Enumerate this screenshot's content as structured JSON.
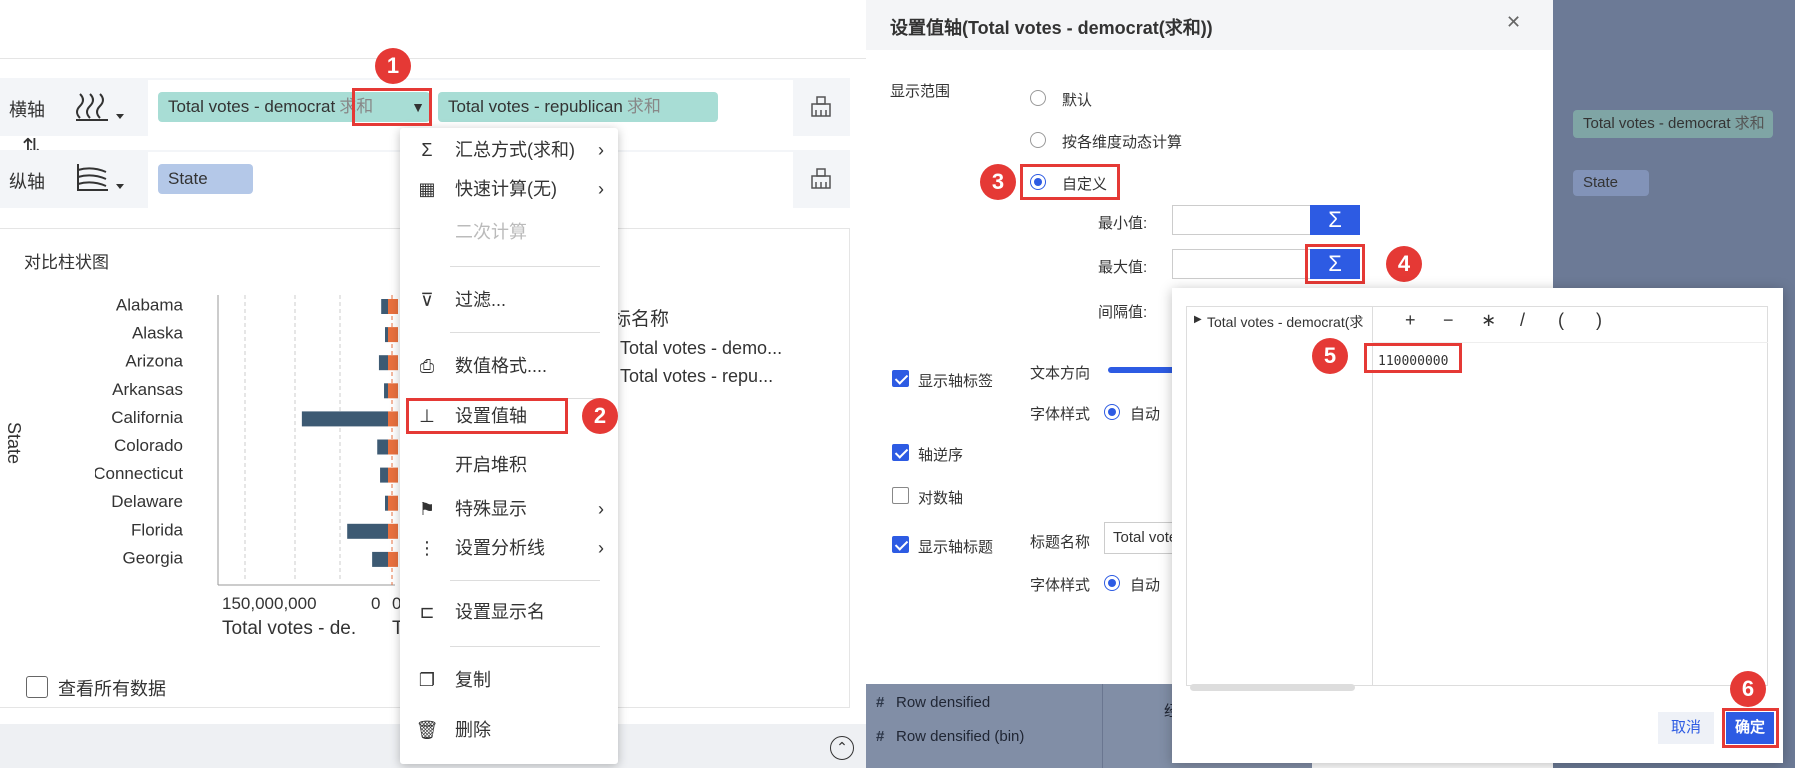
{
  "left": {
    "x_axis_label": "横轴",
    "y_axis_label": "纵轴",
    "swap_icon": "⇅",
    "x_pills": [
      {
        "name": "Total votes - democrat",
        "agg": "求和"
      },
      {
        "name": "Total votes - republican",
        "agg": "求和"
      }
    ],
    "y_pill": "State",
    "chart_title": "对比柱状图",
    "y_axis_title": "State",
    "legend_partial": "标名称",
    "legend_items": [
      "Total votes - demo...",
      "Total votes - repu..."
    ],
    "x_ticks": [
      "150,000,000",
      "0",
      "0"
    ],
    "x_title": "Total votes - de.",
    "x_title_2": "T",
    "view_all": "查看所有数据"
  },
  "chart_data": {
    "type": "bar",
    "categories": [
      "Alabama",
      "Alaska",
      "Arizona",
      "Arkansas",
      "California",
      "Colorado",
      "Connecticut",
      "Delaware",
      "Florida",
      "Georgia"
    ],
    "series": [
      {
        "name": "Total votes - democrat",
        "values": [
          6000000,
          1500000,
          8000000,
          3500000,
          76000000,
          9500000,
          7000000,
          2000000,
          36000000,
          14000000
        ]
      },
      {
        "name": "Total votes - republican",
        "values": [
          1,
          1,
          1,
          1,
          1,
          1,
          1,
          1,
          1,
          1
        ]
      }
    ],
    "colors": [
      "#3d5a73",
      "#e8703e"
    ]
  },
  "menu": {
    "items": [
      {
        "icon": "Σ",
        "label": "汇总方式(求和)",
        "arrow": "›"
      },
      {
        "icon": "▦",
        "label": "快速计算(无)",
        "arrow": "›"
      },
      {
        "icon": "",
        "label": "二次计算",
        "arrow": ""
      },
      {
        "icon": "⊽",
        "label": "过滤...",
        "arrow": ""
      },
      {
        "icon": "⎙",
        "label": "数值格式....",
        "arrow": ""
      },
      {
        "icon": "⊥",
        "label": "设置值轴",
        "arrow": ""
      },
      {
        "icon": "",
        "label": "开启堆积",
        "arrow": ""
      },
      {
        "icon": "⚑",
        "label": "特殊显示",
        "arrow": "›"
      },
      {
        "icon": "⋮",
        "label": "设置分析线",
        "arrow": "›"
      },
      {
        "icon": "⊏",
        "label": "设置显示名",
        "arrow": ""
      },
      {
        "icon": "❐",
        "label": "复制",
        "arrow": ""
      },
      {
        "icon": "🗑",
        "label": "删除",
        "arrow": ""
      }
    ]
  },
  "dialog": {
    "title": "设置值轴(Total votes - democrat(求和))",
    "close": "✕",
    "range_label": "显示范围",
    "opt_default": "默认",
    "opt_dynamic": "按各维度动态计算",
    "opt_custom": "自定义",
    "min_label": "最小值:",
    "max_label": "最大值:",
    "interval_label": "间隔值:",
    "sigma": "Σ",
    "show_axis_label": "显示轴标签",
    "text_direction": "文本方向",
    "font_style": "字体样式",
    "auto": "自动",
    "axis_reverse": "轴逆序",
    "log_axis": "对数轴",
    "show_axis_title": "显示轴标题",
    "title_name": "标题名称",
    "title_value": "Total vote",
    "field_rows": [
      "Row densified",
      "Row densified (bin)"
    ],
    "field_partial": "经"
  },
  "formula": {
    "tree_item": "Total votes - democrat(求",
    "ops": [
      "+",
      "−",
      "∗",
      "/",
      "(",
      ")"
    ],
    "value": "110000000",
    "cancel": "取消",
    "ok": "确定"
  },
  "background": {
    "pill1": "Total votes - democrat",
    "pill1_agg": "求和",
    "pill2": "State"
  },
  "badges": [
    "1",
    "2",
    "3",
    "4",
    "5",
    "6"
  ]
}
